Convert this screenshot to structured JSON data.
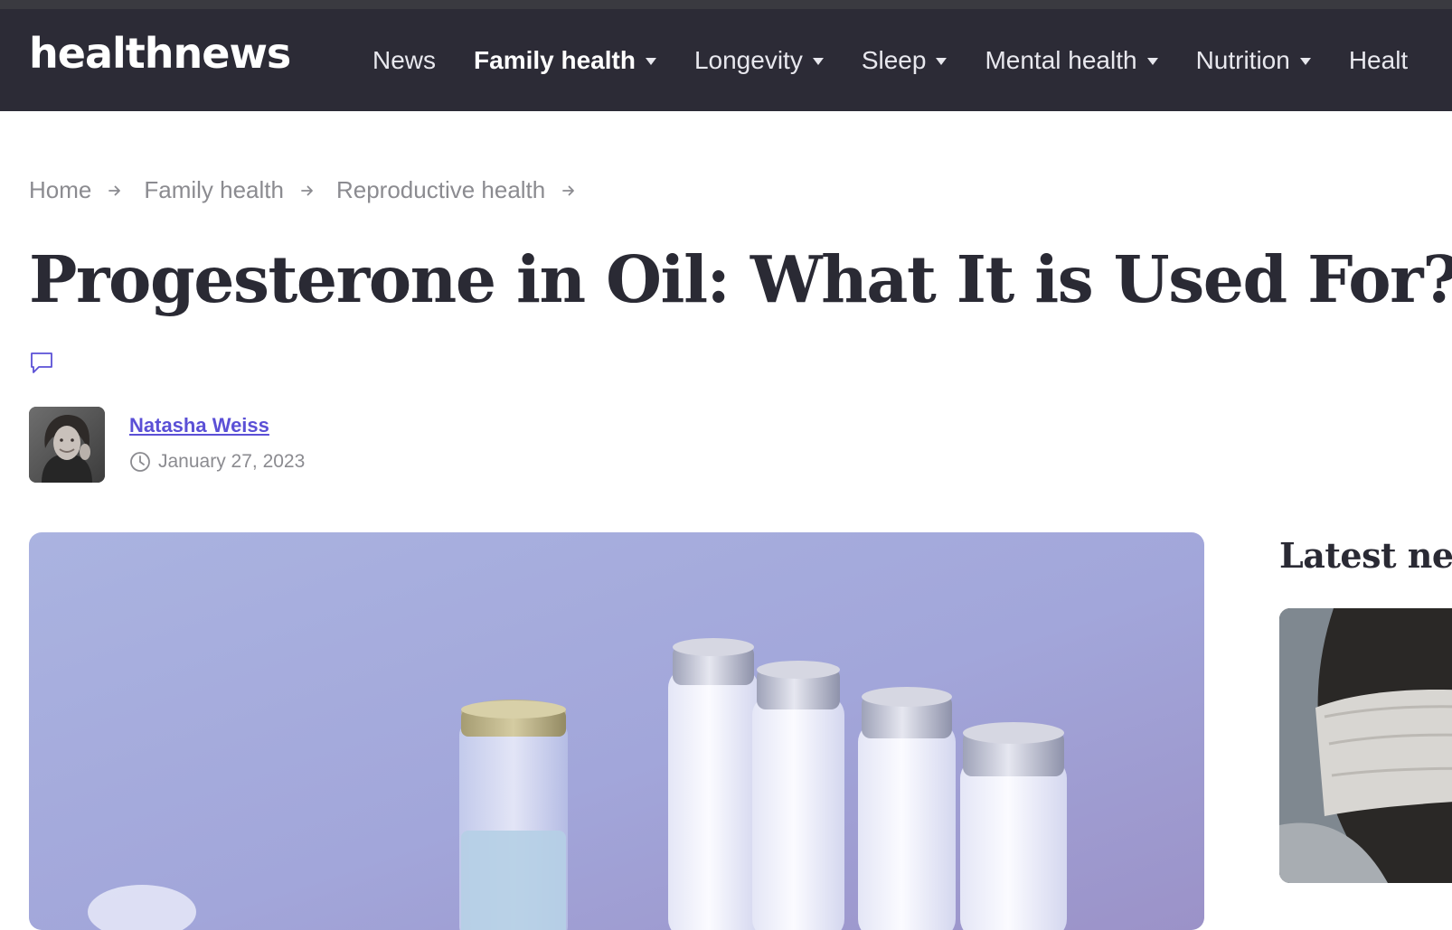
{
  "site": {
    "logo": "healthnews"
  },
  "nav": {
    "items": [
      {
        "label": "News",
        "dropdown": false,
        "active": false
      },
      {
        "label": "Family health",
        "dropdown": true,
        "active": true
      },
      {
        "label": "Longevity",
        "dropdown": true,
        "active": false
      },
      {
        "label": "Sleep",
        "dropdown": true,
        "active": false
      },
      {
        "label": "Mental health",
        "dropdown": true,
        "active": false
      },
      {
        "label": "Nutrition",
        "dropdown": true,
        "active": false
      },
      {
        "label": "Healt",
        "dropdown": false,
        "active": false
      }
    ]
  },
  "breadcrumb": [
    "Home",
    "Family health",
    "Reproductive health"
  ],
  "article": {
    "title": "Progesterone in Oil: What It is Used For?",
    "author": "Natasha Weiss",
    "date": "January 27, 2023",
    "hero_image": "medicine-vials-photo"
  },
  "sidebar": {
    "heading": "Latest new",
    "image": "news-thumbnail-photo"
  },
  "colors": {
    "nav_bg": "#2c2b36",
    "author_link": "#5b50d6",
    "title": "#2a2a34",
    "meta": "#8b8b90"
  }
}
